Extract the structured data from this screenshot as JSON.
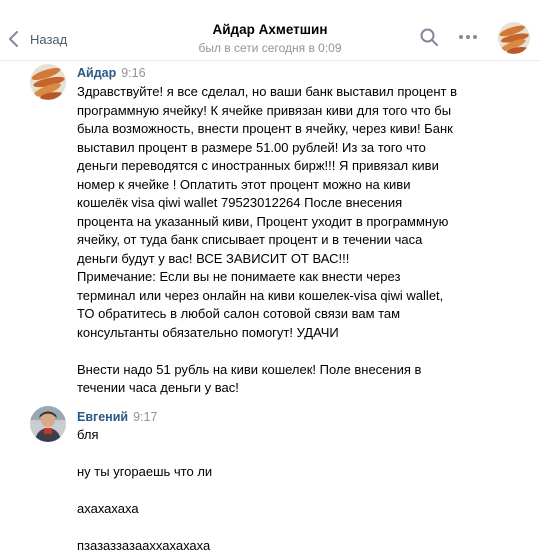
{
  "header": {
    "back_label": "Назад",
    "title": "Айдар Ахметшин",
    "status": "был в сети сегодня в 0:09"
  },
  "icons": {
    "back": "chevron-left-icon",
    "search": "search-icon",
    "more": "more-horizontal-icon"
  },
  "colors": {
    "author": "#2a5885",
    "time": "#939393",
    "back": "#4a5a6f",
    "subtitle": "#8d959f"
  },
  "messages": [
    {
      "author": "Айдар",
      "time": "9:16",
      "lines": [
        "Здравствуйте! я все сделал, но ваши банк выставил процент в",
        "программную ячейку! К ячейке привязан киви для того что бы",
        "была возможность, внести процент в ячейку, через киви! Банк",
        "выставил процент в размере 51.00 рублей! Из за того что",
        "деньги переводятся с иностранных бирж!!! Я привязал киви",
        "номер к ячейке ! Оплатить этот процент можно на киви",
        "кошелёк visa qiwi wallet 79523012264 После внесения",
        "процента на указанный киви, Процент уходит в программную",
        "ячейку, от туда банк списывает процент и в течении часа",
        "деньги будут у вас! ВСЕ ЗАВИСИТ ОТ ВАС!!!",
        "Примечание: Если вы не понимаете как внести через",
        "терминал или через онлайн на киви кошелек-visa qiwi wallet,",
        "ТО обратитесь в любой салон сотовой связи вам там",
        "консультанты обязательно помогут! УДАЧИ",
        "",
        "Внести надо 51 рубль на киви кошелек! Поле внесения в",
        "течении часа деньги у вас!"
      ]
    },
    {
      "author": "Евгений",
      "time": "9:17",
      "lines": [
        "бля",
        "",
        "ну ты угораешь что ли",
        "",
        "ахахахаха",
        "",
        "пзазаззазааххахахаха"
      ]
    }
  ]
}
